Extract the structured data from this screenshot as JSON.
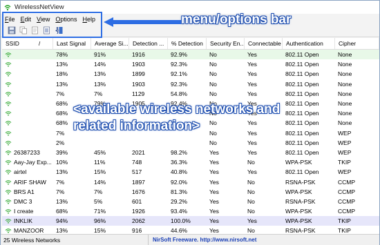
{
  "window": {
    "title": "WirelessNetView"
  },
  "menu": [
    {
      "label": "File",
      "key": "F",
      "rest": "ile"
    },
    {
      "label": "Edit",
      "key": "E",
      "rest": "dit"
    },
    {
      "label": "View",
      "key": "V",
      "rest": "iew"
    },
    {
      "label": "Options",
      "key": "O",
      "rest": "ptions"
    },
    {
      "label": "Help",
      "key": "H",
      "rest": "elp"
    }
  ],
  "toolbar": {
    "buttons": [
      "save-icon",
      "copy-icon",
      "html-report-icon",
      "properties-icon",
      "exit-icon"
    ]
  },
  "annotations": {
    "menu_bar": "menu/options bar",
    "networks_line1": "<available wireless networks and",
    "networks_line2": "related information>"
  },
  "table": {
    "columns": [
      "SSID",
      "/",
      "Last Signal",
      "Average Si...",
      "Detection ...",
      "% Detection",
      "Security En...",
      "Connectable",
      "Authentication",
      "Cipher"
    ],
    "rows": [
      {
        "ssid": "",
        "last": "78%",
        "avg": "91%",
        "count": "1916",
        "pct": "92.9%",
        "sec": "No",
        "conn": "Yes",
        "auth": "802.11 Open",
        "cipher": "None",
        "hl": "green"
      },
      {
        "ssid": "",
        "last": "13%",
        "avg": "14%",
        "count": "1903",
        "pct": "92.3%",
        "sec": "No",
        "conn": "Yes",
        "auth": "802.11 Open",
        "cipher": "None",
        "hl": ""
      },
      {
        "ssid": "",
        "last": "18%",
        "avg": "13%",
        "count": "1899",
        "pct": "92.1%",
        "sec": "No",
        "conn": "Yes",
        "auth": "802.11 Open",
        "cipher": "None",
        "hl": ""
      },
      {
        "ssid": "",
        "last": "13%",
        "avg": "13%",
        "count": "1903",
        "pct": "92.3%",
        "sec": "No",
        "conn": "Yes",
        "auth": "802.11 Open",
        "cipher": "None",
        "hl": ""
      },
      {
        "ssid": "",
        "last": "7%",
        "avg": "7%",
        "count": "1129",
        "pct": "54.8%",
        "sec": "No",
        "conn": "Yes",
        "auth": "802.11 Open",
        "cipher": "None",
        "hl": ""
      },
      {
        "ssid": "",
        "last": "68%",
        "avg": "79%",
        "count": "1905",
        "pct": "92.4%",
        "sec": "No",
        "conn": "Yes",
        "auth": "802.11 Open",
        "cipher": "None",
        "hl": ""
      },
      {
        "ssid": "",
        "last": "68%",
        "avg": "",
        "count": "",
        "pct": "",
        "sec": "No",
        "conn": "Yes",
        "auth": "802.11 Open",
        "cipher": "None",
        "hl": ""
      },
      {
        "ssid": "",
        "last": "68%",
        "avg": "",
        "count": "",
        "pct": "",
        "sec": "No",
        "conn": "Yes",
        "auth": "802.11 Open",
        "cipher": "None",
        "hl": ""
      },
      {
        "ssid": "",
        "last": "7%",
        "avg": "",
        "count": "",
        "pct": "",
        "sec": "No",
        "conn": "Yes",
        "auth": "802.11 Open",
        "cipher": "WEP",
        "hl": ""
      },
      {
        "ssid": "",
        "last": "2%",
        "avg": "",
        "count": "",
        "pct": "",
        "sec": "No",
        "conn": "Yes",
        "auth": "802.11 Open",
        "cipher": "WEP",
        "hl": ""
      },
      {
        "ssid": "26387233",
        "last": "39%",
        "avg": "45%",
        "count": "2021",
        "pct": "98.2%",
        "sec": "Yes",
        "conn": "Yes",
        "auth": "802.11 Open",
        "cipher": "WEP",
        "hl": ""
      },
      {
        "ssid": "Aay-Jay Exp...",
        "last": "10%",
        "avg": "11%",
        "count": "748",
        "pct": "36.3%",
        "sec": "Yes",
        "conn": "No",
        "auth": "WPA-PSK",
        "cipher": "TKIP",
        "hl": ""
      },
      {
        "ssid": "airtel",
        "last": "13%",
        "avg": "15%",
        "count": "517",
        "pct": "40.8%",
        "sec": "Yes",
        "conn": "Yes",
        "auth": "802.11 Open",
        "cipher": "WEP",
        "hl": ""
      },
      {
        "ssid": "ARIF SHAW",
        "last": "7%",
        "avg": "14%",
        "count": "1897",
        "pct": "92.0%",
        "sec": "Yes",
        "conn": "No",
        "auth": "RSNA-PSK",
        "cipher": "CCMP",
        "hl": ""
      },
      {
        "ssid": "BRS A1",
        "last": "7%",
        "avg": "7%",
        "count": "1676",
        "pct": "81.3%",
        "sec": "Yes",
        "conn": "No",
        "auth": "WPA-PSK",
        "cipher": "CCMP",
        "hl": ""
      },
      {
        "ssid": "DMC 3",
        "last": "13%",
        "avg": "5%",
        "count": "601",
        "pct": "29.2%",
        "sec": "Yes",
        "conn": "No",
        "auth": "RSNA-PSK",
        "cipher": "CCMP",
        "hl": ""
      },
      {
        "ssid": "I create",
        "last": "68%",
        "avg": "71%",
        "count": "1926",
        "pct": "93.4%",
        "sec": "Yes",
        "conn": "No",
        "auth": "WPA-PSK",
        "cipher": "CCMP",
        "hl": ""
      },
      {
        "ssid": "INKLIK",
        "last": "94%",
        "avg": "96%",
        "count": "2062",
        "pct": "100.0%",
        "sec": "Yes",
        "conn": "Yes",
        "auth": "WPA-PSK",
        "cipher": "TKIP",
        "hl": "lav"
      },
      {
        "ssid": "MANZOOR",
        "last": "13%",
        "avg": "15%",
        "count": "916",
        "pct": "44.6%",
        "sec": "Yes",
        "conn": "No",
        "auth": "RSNA-PSK",
        "cipher": "TKIP",
        "hl": ""
      }
    ]
  },
  "status": {
    "count": "25 Wireless Networks",
    "credit": "NirSoft Freeware.  http://www.nirsoft.net"
  },
  "colors": {
    "annotation": "#2d6de3",
    "signal": "#2aa52a",
    "link": "#1a3fb5"
  }
}
